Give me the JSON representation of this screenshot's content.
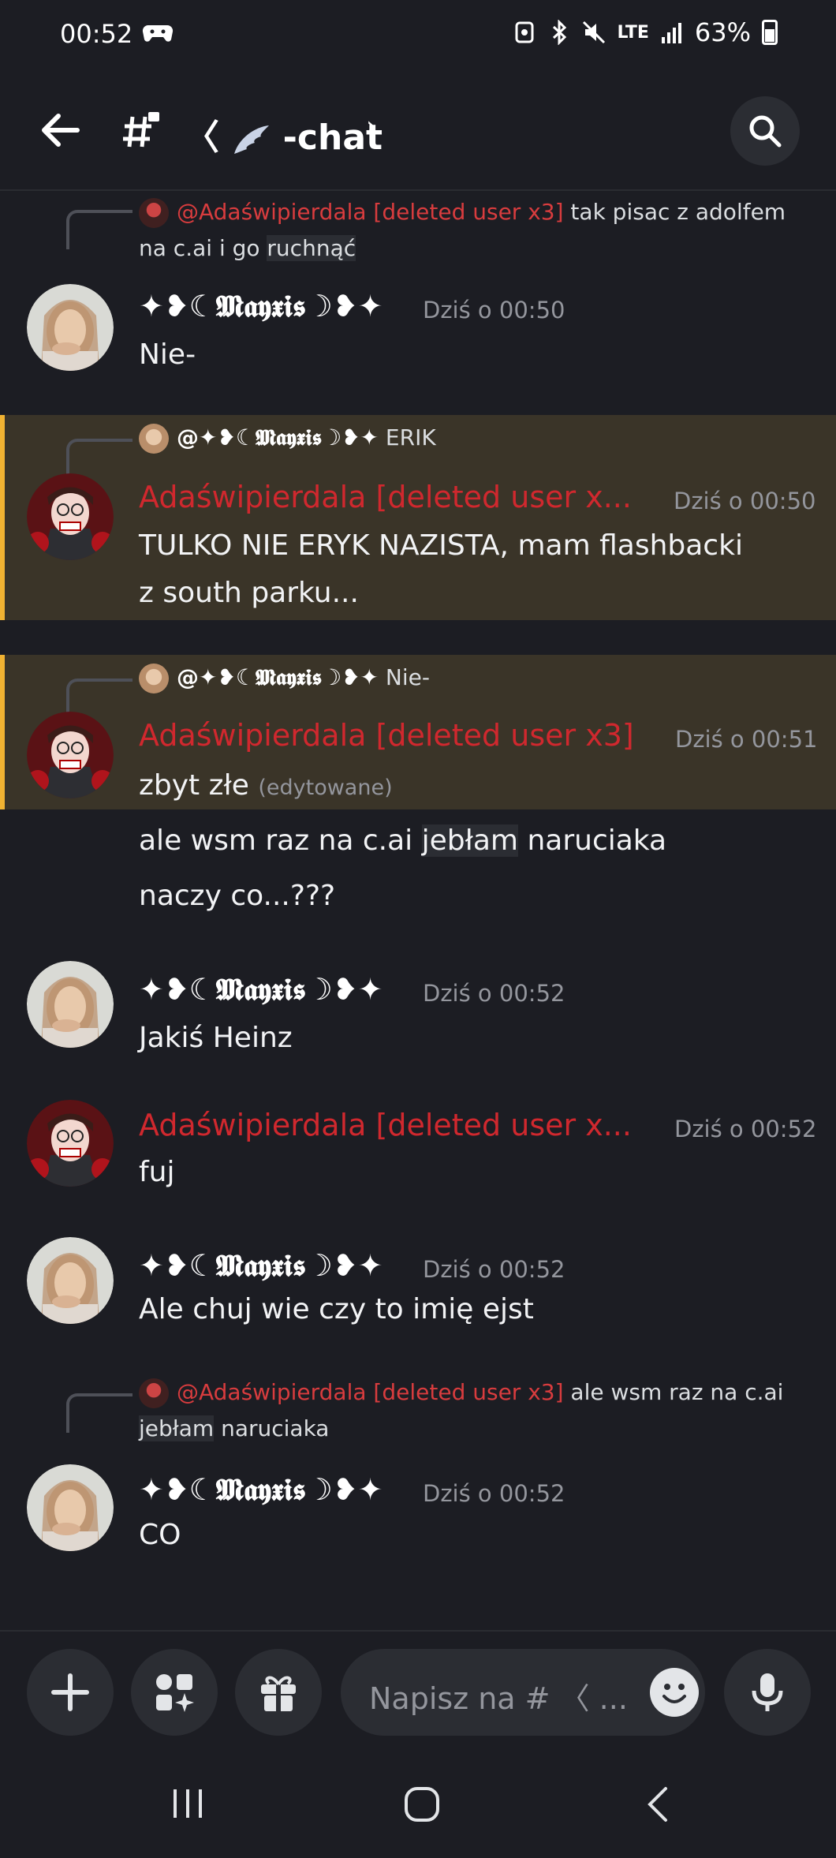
{
  "status_bar": {
    "time": "00:52",
    "battery": "63%",
    "network": "LTE"
  },
  "header": {
    "channel_name": "-chat",
    "back_icon": "arrow-left-icon",
    "search_icon": "search-icon"
  },
  "messages": [
    {
      "reply": {
        "mention": "@Adaświpierdala [deleted user x3]",
        "text_before": " tak pisac z adolfem na c.ai i go ",
        "text_hl": "ruchnąć"
      },
      "author": "✦❥☾𝕸𝖆𝖞𝖝𝖎𝖘☽❥✦",
      "time": "Dziś o 00:50",
      "text": "Nie-"
    },
    {
      "reply": {
        "mention": "@✦❥☾𝕸𝖆𝖞𝖝𝖎𝖘☽❥✦",
        "text": " ERIK"
      },
      "author": "Adaświpierdala [deleted user x...",
      "time": "Dziś o 00:50",
      "text_line1": "TULKO NIE ERYK NAZISTA, mam flashbacki",
      "text_line2": "z south parku..."
    },
    {
      "reply": {
        "mention": "@✦❥☾𝕸𝖆𝖞𝖝𝖎𝖘☽❥✦",
        "text": " Nie-"
      },
      "author": "Adaświpierdala [deleted user x3]",
      "time": "Dziś o 00:51",
      "text": "zbyt złe",
      "edited": "(edytowane)",
      "follow1_a": "ale wsm raz na c.ai ",
      "follow1_hl": "jebłam",
      "follow1_b": " naruciaka",
      "follow2": "naczy co...???"
    },
    {
      "author": "✦❥☾𝕸𝖆𝖞𝖝𝖎𝖘☽❥✦",
      "time": "Dziś o 00:52",
      "text": "Jakiś Heinz"
    },
    {
      "author": "Adaświpierdala [deleted user x...",
      "time": "Dziś o 00:52",
      "text": "fuj"
    },
    {
      "author": "✦❥☾𝕸𝖆𝖞𝖝𝖎𝖘☽❥✦",
      "time": "Dziś o 00:52",
      "text": "Ale chuj wie czy to imię ejst"
    },
    {
      "reply": {
        "mention": "@Adaświpierdala [deleted user x3]",
        "text_before": " ale wsm raz na c.ai ",
        "text_hl": "jebłam",
        "text_after": " naruciaka"
      },
      "author": "✦❥☾𝕸𝖆𝖞𝖝𝖎𝖘☽❥✦",
      "time": "Dziś o 00:52",
      "text": "CO"
    }
  ],
  "input": {
    "placeholder": "Napisz na # 〈 ...",
    "add_icon": "plus-icon",
    "apps_icon": "apps-icon",
    "gift_icon": "gift-icon",
    "emoji_icon": "emoji-icon",
    "mic_icon": "microphone-icon"
  },
  "nav": {
    "recents_icon": "recents-icon",
    "home_icon": "home-icon",
    "back_icon": "back-chevron-icon"
  },
  "colors": {
    "background": "#1c1d23",
    "highlight_bg": "#3a3428",
    "highlight_border": "#f0b232",
    "mention_red": "#d0282e",
    "timestamp": "#94969d"
  }
}
